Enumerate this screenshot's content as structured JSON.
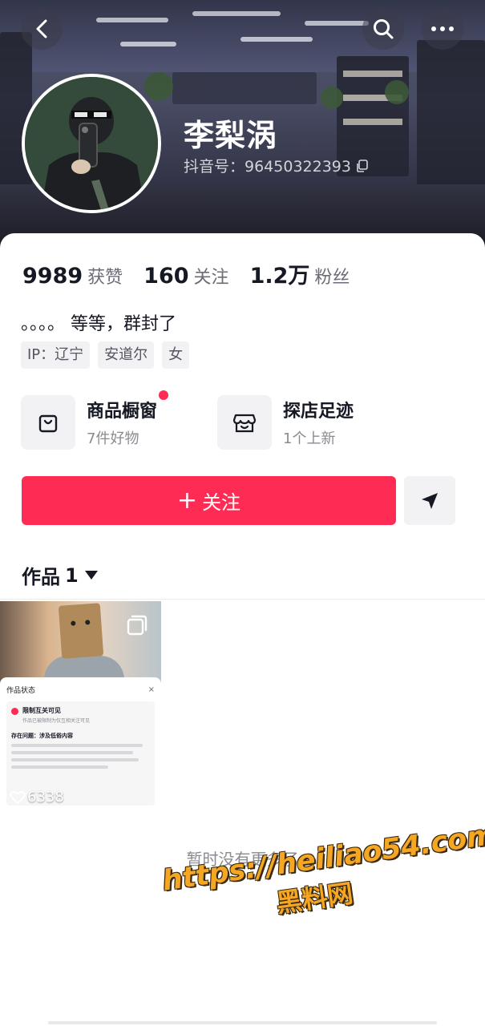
{
  "header": {
    "username": "李梨涡",
    "douyin_id": "抖音号：96450322393"
  },
  "stats": [
    {
      "value": "9989",
      "label": "获赞"
    },
    {
      "value": "160",
      "label": "关注"
    },
    {
      "value": "1.2万",
      "label": "粉丝"
    }
  ],
  "bio": "。。。。 等等，群封了",
  "tags": [
    "IP：辽宁",
    "安道尔",
    "女"
  ],
  "shop": {
    "window_title": "商品橱窗",
    "window_sub": "7件好物",
    "explore_title": "探店足迹",
    "explore_sub": "1个上新"
  },
  "actions": {
    "follow_plus": "+",
    "follow_label": "关注"
  },
  "works": {
    "tab_label": "作品",
    "count": "1"
  },
  "video": {
    "likes": "6338",
    "overlay_header": "作品状态",
    "overlay_close": "×",
    "overlay_title": "限制互关可见",
    "overlay_sub": "作品已被限制为仅互相关注可见",
    "overlay_issue": "存在问题：涉及低俗内容"
  },
  "footer": {
    "no_more": "暂时没有更多了"
  },
  "watermark": {
    "url": "https://heiliao54.com",
    "name": "黑料网"
  },
  "colors": {
    "accent": "#fe2c55",
    "text_primary": "#161823",
    "text_secondary": "#6b6c75",
    "chip_bg": "#f2f2f4",
    "watermark": "#f5a623"
  },
  "icons": [
    "back-arrow-icon",
    "search-icon",
    "more-icon",
    "copy-icon",
    "shopping-bag-icon",
    "storefront-icon",
    "send-icon",
    "caret-down-icon",
    "multi-image-icon",
    "heart-icon"
  ]
}
